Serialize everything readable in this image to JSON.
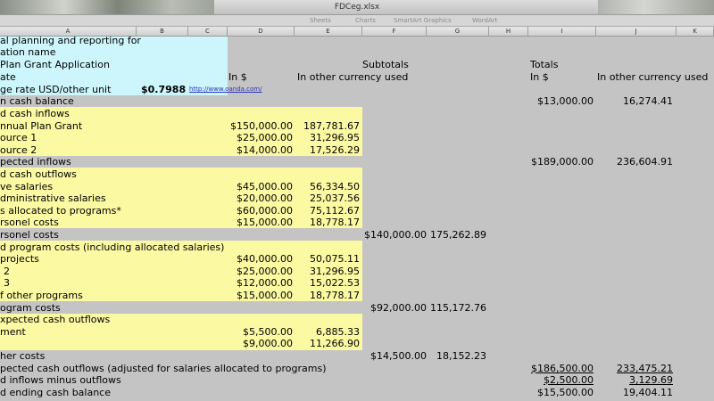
{
  "window": {
    "title": "FDCeg.xlsx"
  },
  "ribbon": {
    "tabs": [
      "Sheets",
      "Charts",
      "SmartArt Graphics",
      "WordArt"
    ]
  },
  "columns": [
    "A",
    "B",
    "C",
    "D",
    "E",
    "F",
    "G",
    "H",
    "I",
    "J",
    "K"
  ],
  "rows": [
    {
      "a": "al planning and reporting for"
    },
    {
      "a": "ation name"
    },
    {
      "a": "Plan Grant Application"
    },
    {
      "a": "ate",
      "d": "In $",
      "e": "In other currency used",
      "f": "Subtotals",
      "i": "Totals"
    },
    {
      "a": "ge rate  USD/other unit",
      "b": "$0.7988",
      "c": "http://www.oanda.com/",
      "i": "In $",
      "j": "In other currency used"
    },
    {
      "a": "n cash balance",
      "i": "$13,000.00",
      "j": "16,274.41"
    },
    {
      "a": "d cash inflows"
    },
    {
      "a": "nnual Plan Grant",
      "d": "$150,000.00",
      "e": "187,781.67"
    },
    {
      "a": "ource 1",
      "d": "$25,000.00",
      "e": "31,296.95"
    },
    {
      "a": "ource 2",
      "d": "$14,000.00",
      "e": "17,526.29"
    },
    {
      "a": "pected inflows",
      "i": "$189,000.00",
      "j": "236,604.91"
    },
    {
      "a": "d cash outflows"
    },
    {
      "a": "ve salaries",
      "d": "$45,000.00",
      "e": "56,334.50"
    },
    {
      "a": "dministrative salaries",
      "d": "$20,000.00",
      "e": "25,037.56"
    },
    {
      "a": "s allocated to programs*",
      "d": "$60,000.00",
      "e": "75,112.67"
    },
    {
      "a": "rsonel costs",
      "d": "$15,000.00",
      "e": "18,778.17"
    },
    {
      "a": "rsonel costs",
      "f": "$140,000.00",
      "g": "175,262.89"
    },
    {
      "a": "d program costs (including allocated salaries)"
    },
    {
      "a": "projects",
      "d": "$40,000.00",
      "e": "50,075.11"
    },
    {
      "a": "2",
      "d": "$25,000.00",
      "e": "31,296.95"
    },
    {
      "a": "3",
      "d": "$12,000.00",
      "e": "15,022.53"
    },
    {
      "a": "f other programs",
      "d": "$15,000.00",
      "e": "18,778.17"
    },
    {
      "a": "ogram costs",
      "f": "$92,000.00",
      "g": "115,172.76"
    },
    {
      "a": "xpected cash outflows"
    },
    {
      "a": "ment",
      "d": "$5,500.00",
      "e": "6,885.33"
    },
    {
      "a": "",
      "d": "$9,000.00",
      "e": "11,266.90"
    },
    {
      "a": "her costs",
      "f": "$14,500.00",
      "g": "18,152.23"
    },
    {
      "a": "pected cash outflows (adjusted for salaries allocated to programs)",
      "i": "$186,500.00",
      "j": "233,475.21"
    },
    {
      "a": "d inflows minus outflows",
      "i": "$2,500.00",
      "j": "3,129.69"
    },
    {
      "a": "d ending cash balance",
      "i": "$15,500.00",
      "j": "19,404.11"
    }
  ],
  "colors": {
    "cyan_highlight": "#ccf6fb",
    "yellow_highlight": "#fbf9a2",
    "sheet_bg": "#c4c4c4",
    "link": "#2a34b8"
  }
}
